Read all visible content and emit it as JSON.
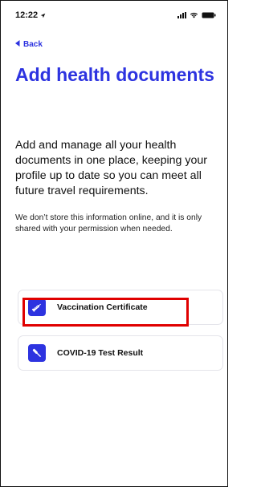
{
  "status_bar": {
    "time": "12:22"
  },
  "nav": {
    "back_label": "Back"
  },
  "header": {
    "title": "Add health documents"
  },
  "content": {
    "intro": "Add and manage all your health documents in one place, keeping your profile up to date so you can meet all future travel requirements.",
    "note": "We don’t store this information online, and it is only shared with your permission when needed."
  },
  "documents": [
    {
      "label": "Vaccination Certificate",
      "icon": "syringe-icon"
    },
    {
      "label": "COVID-19 Test Result",
      "icon": "test-swab-icon"
    }
  ],
  "colors": {
    "accent": "#2d33e0",
    "highlight": "#e00000"
  }
}
